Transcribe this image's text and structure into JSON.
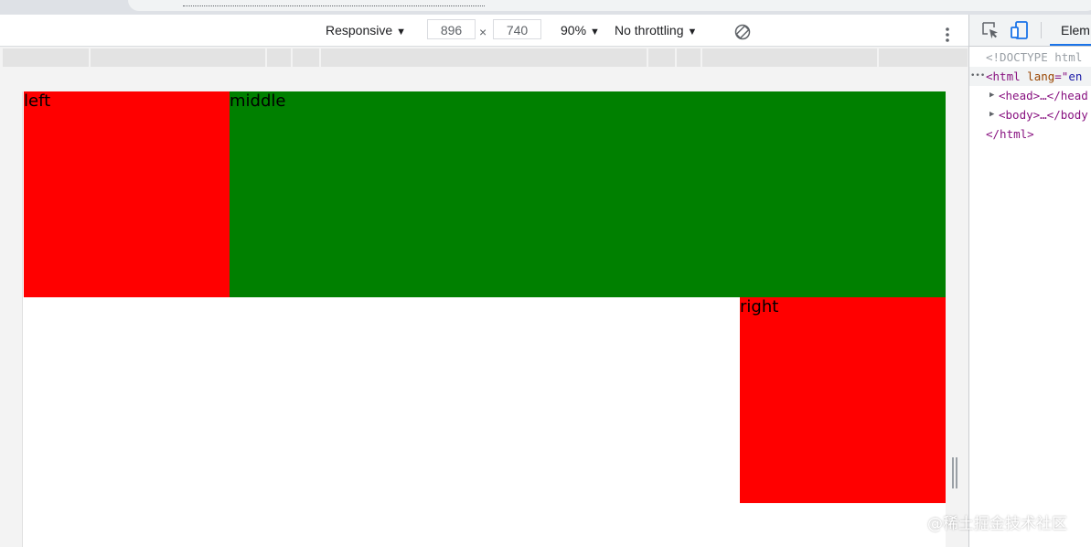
{
  "device_toolbar": {
    "device_mode": "Responsive",
    "width": "896",
    "height": "740",
    "dimension_separator": "×",
    "zoom": "90%",
    "throttling": "No throttling",
    "menu_icon": "kebab-menu-icon",
    "rotate_icon": "rotate-icon"
  },
  "viewport": {
    "boxes": {
      "left": {
        "label": "left",
        "color": "#ff0000"
      },
      "middle": {
        "label": "middle",
        "color": "#008000"
      },
      "right": {
        "label": "right",
        "color": "#ff0000"
      }
    }
  },
  "devtools": {
    "tabs": [
      {
        "label": "Elem",
        "active": true
      }
    ],
    "inspect_icon": "inspect-element-icon",
    "device_icon": "device-toggle-icon",
    "dom_tree": {
      "doctype": "<!DOCTYPE html",
      "html_open_tag": "<html",
      "html_attr_name": "lang",
      "html_attr_eq": "=\"",
      "html_attr_value": "en",
      "head": "<head>…</head",
      "body": "<body>…</body",
      "html_close": "</html>",
      "dots": "•••"
    }
  },
  "watermark": "@稀土掘金技术社区",
  "colors": {
    "accent": "#1a73e8"
  }
}
